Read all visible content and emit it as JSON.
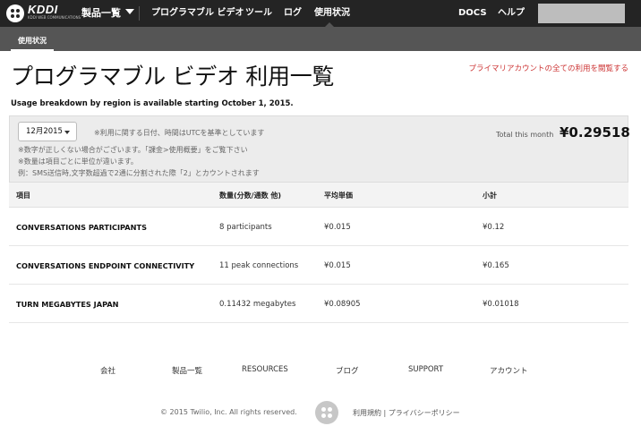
{
  "nav": {
    "brand": "KDDI",
    "brand_sub": "KDDI WEB COMMUNICATIONS",
    "products": "製品一覧",
    "items": [
      "プログラマブル ビデオ",
      "ツール",
      "ログ",
      "使用状況"
    ],
    "docs": "DOCS",
    "help": "ヘルプ"
  },
  "subnav": {
    "tab": "使用状況"
  },
  "page": {
    "title": "プログラマブル ビデオ 利用一覧",
    "primary_link": "プライマリアカウントの全ての利用を閲覧する",
    "region_note": "Usage breakdown by region is available starting October 1, 2015."
  },
  "summary": {
    "month": "12月2015",
    "notes": [
      "※利用に関する日付、時間はUTCを基準としています",
      "※数字が正しくない場合がございます。「課金>使用概要」をご覧下さい",
      "※数量は項目ごとに単位が違います。",
      "例：SMS送信時,文字数超過で2通に分割された際「2」とカウントされます"
    ],
    "total_label": "Total this month",
    "total_value": "¥0.29518"
  },
  "table": {
    "headers": [
      "項目",
      "数量(分数/通数 他)",
      "平均単価",
      "小計"
    ],
    "rows": [
      {
        "item": "CONVERSATIONS PARTICIPANTS",
        "quantity": "8 participants",
        "unit_price": "¥0.015",
        "subtotal": "¥0.12"
      },
      {
        "item": "CONVERSATIONS ENDPOINT CONNECTIVITY",
        "quantity": "11 peak connections",
        "unit_price": "¥0.015",
        "subtotal": "¥0.165"
      },
      {
        "item": "TURN MEGABYTES JAPAN",
        "quantity": "0.11432 megabytes",
        "unit_price": "¥0.08905",
        "subtotal": "¥0.01018"
      }
    ]
  },
  "footer": {
    "links": [
      "会社",
      "製品一覧",
      "RESOURCES",
      "ブログ",
      "SUPPORT",
      "アカウント"
    ],
    "copyright": "© 2015 Twilio, Inc. All rights reserved.",
    "legal": "利用規約 | プライバシーポリシー"
  },
  "colors": {
    "nav_bg": "#242424",
    "subnav_bg": "#555555",
    "link_red": "#cc3333",
    "panel_bg": "#ececec"
  }
}
